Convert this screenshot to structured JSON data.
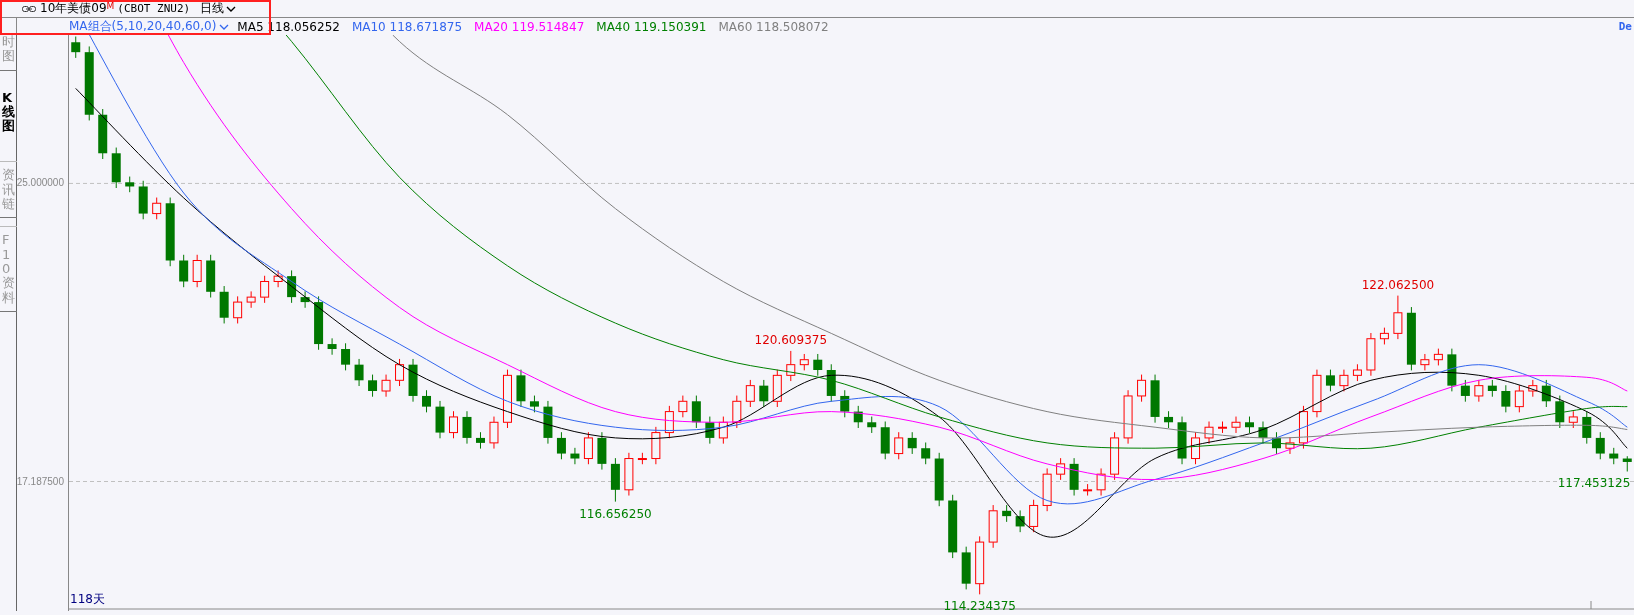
{
  "header": {
    "title": "10年美债09",
    "badge": "M",
    "code": "(CBOT ZNU2)",
    "period": "日线"
  },
  "indicator_group": "MA组合(5,10,20,40,60,0)",
  "indicators": [
    {
      "label": "MA5",
      "value": "118.056252",
      "color": "#000000"
    },
    {
      "label": "MA10",
      "value": "118.671875",
      "color": "#3366ee"
    },
    {
      "label": "MA20",
      "value": "119.514847",
      "color": "#ff00ff"
    },
    {
      "label": "MA40",
      "value": "119.150391",
      "color": "#008000"
    },
    {
      "label": "MA60",
      "value": "118.508072",
      "color": "#808080"
    }
  ],
  "right_label": "De",
  "tabs": [
    {
      "label": "时图",
      "selected": false
    },
    {
      "label": "K线图",
      "selected": true
    },
    {
      "label": "资讯链",
      "selected": false
    },
    {
      "label": "F10资料",
      "selected": false
    }
  ],
  "axis_labels": [
    "25.000000",
    "17.187500"
  ],
  "price_labels": [
    "116.656250",
    "120.609375",
    "114.234375",
    "122.062500",
    "117.453125"
  ],
  "period_label": "118天"
}
